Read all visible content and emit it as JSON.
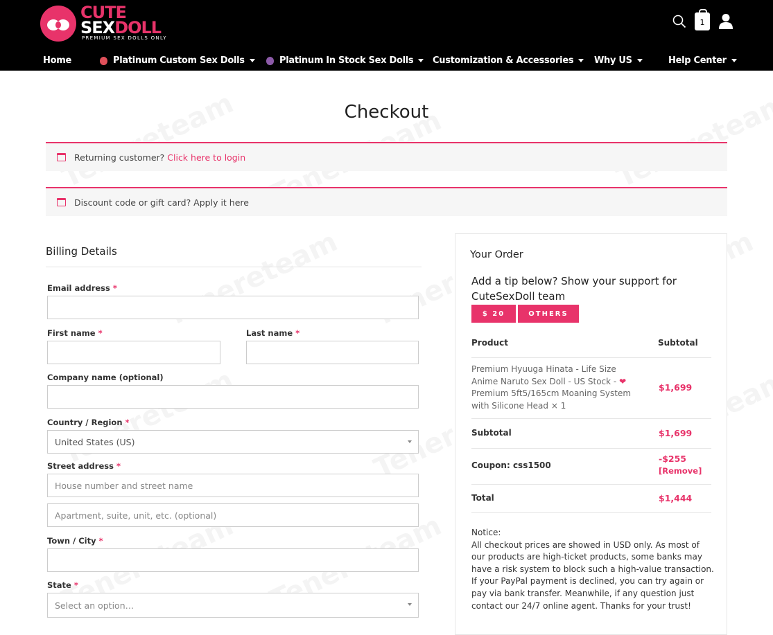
{
  "header": {
    "logo_cute": "CUTE",
    "logo_sex": "SEX",
    "logo_doll": "DOLL",
    "logo_tagline": "PREMIUM SEX DOLLS ONLY",
    "cart_count": "1",
    "icons": [
      "search-icon",
      "cart-icon",
      "user-icon"
    ]
  },
  "nav": {
    "items": [
      {
        "label": "Home"
      },
      {
        "label": "Platinum Custom Sex Dolls"
      },
      {
        "label": "Platinum In Stock Sex Dolls"
      },
      {
        "label": "Customization & Accessories"
      },
      {
        "label": "Why US"
      },
      {
        "label": "Help Center"
      }
    ]
  },
  "page": {
    "title": "Checkout",
    "watermark": "Tenereteam"
  },
  "notices": {
    "returning_text": "Returning customer?",
    "returning_link": "Click here to login",
    "discount_text": "Discount code or gift card? Apply it here"
  },
  "billing": {
    "title": "Billing Details",
    "email_label": "Email address",
    "first_name_label": "First name",
    "last_name_label": "Last name",
    "company_label": "Company name (optional)",
    "country_label": "Country / Region",
    "country_value": "United States (US)",
    "street_label": "Street address",
    "street_placeholder": "House number and street name",
    "apartment_placeholder": "Apartment, suite, unit, etc. (optional)",
    "city_label": "Town / City",
    "state_label": "State",
    "state_placeholder": "Select an option…",
    "required_mark": "*"
  },
  "order": {
    "title": "Your Order",
    "tip_text": "Add a tip below? Show your support for CuteSexDoll team",
    "tip_buttons": [
      "$ 20",
      "OTHERS"
    ],
    "col_product": "Product",
    "col_subtotal": "Subtotal",
    "product_name_a": "Premium Hyuuga Hinata - Life Size Anime Naruto Sex Doll - US Stock -",
    "product_heart": "❤",
    "product_name_b": "Premium 5ft5/165cm Moaning System with Silicone Head",
    "product_qty": "× 1",
    "product_price": "$1,699",
    "subtotal_label": "Subtotal",
    "subtotal_value": "$1,699",
    "coupon_label": "Coupon: css1500",
    "coupon_value": "-$255",
    "coupon_remove": "[Remove]",
    "total_label": "Total",
    "total_value": "$1,444",
    "notice": "Notice:\nAll checkout prices are showed in USD only. As most of our products are high-ticket products, some banks may have a risk system to block such a high-value transaction. If your PayPal payment is declined, you can try again or pay via bank transfer. Meanwhile, if any question just contact our 24/7 online agent. Thanks for your trust!"
  }
}
